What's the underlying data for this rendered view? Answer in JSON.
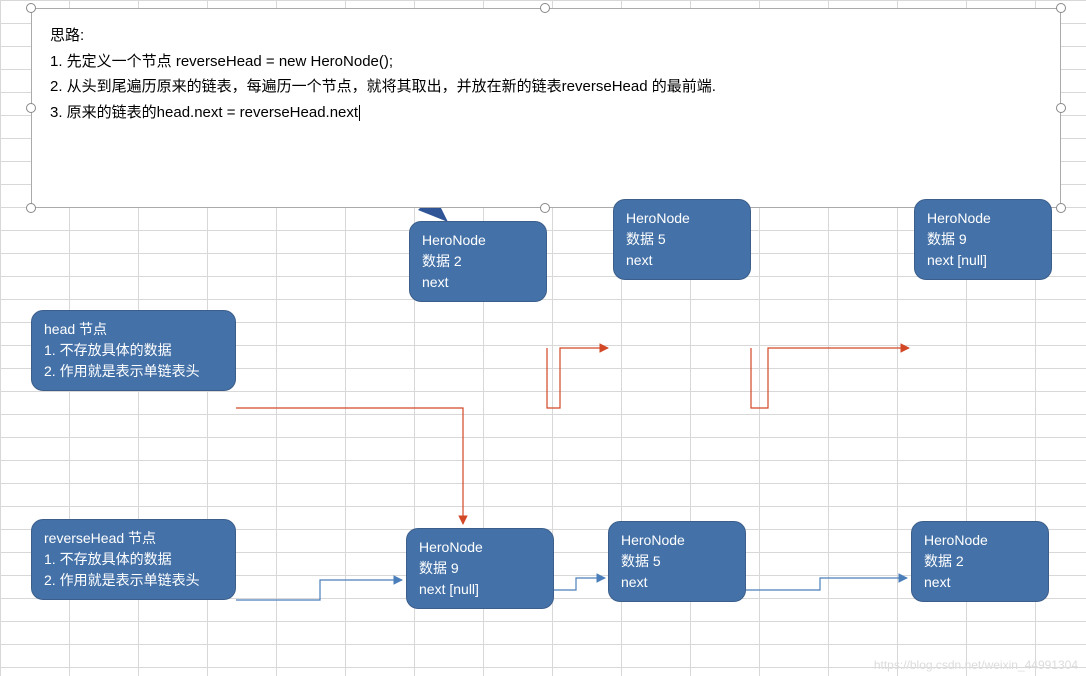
{
  "textbox": {
    "title": "思路:",
    "line1": "1. 先定义一个节点 reverseHead = new HeroNode();",
    "line2": "2. 从头到尾遍历原来的链表，每遍历一个节点，就将其取出，并放在新的链表reverseHead 的最前端.",
    "line3": "3. 原来的链表的head.next = reverseHead.next"
  },
  "nodes": {
    "top1": {
      "l1": "HeroNode",
      "l2": "数据 2",
      "l3": "next"
    },
    "top2": {
      "l1": "HeroNode",
      "l2": "数据 5",
      "l3": "next"
    },
    "top3": {
      "l1": "HeroNode",
      "l2": "数据 9",
      "l3": "next [null]"
    },
    "head": {
      "l1": "head 节点",
      "l2": "1. 不存放具体的数据",
      "l3": "2. 作用就是表示单链表头"
    },
    "rev": {
      "l1": "reverseHead 节点",
      "l2": "1. 不存放具体的数据",
      "l3": "2. 作用就是表示单链表头"
    },
    "bot1": {
      "l1": "HeroNode",
      "l2": "数据 9",
      "l3": "next [null]"
    },
    "bot2": {
      "l1": "HeroNode",
      "l2": "数据 5",
      "l3": "next"
    },
    "bot3": {
      "l1": "HeroNode",
      "l2": "数据 2",
      "l3": "next"
    }
  },
  "arrow_color_red": "#D24726",
  "arrow_color_blue": "#4A7EBB",
  "arrow_color_dark": "#2F5597",
  "watermark": "https://blog.csdn.net/weixin_44991304"
}
